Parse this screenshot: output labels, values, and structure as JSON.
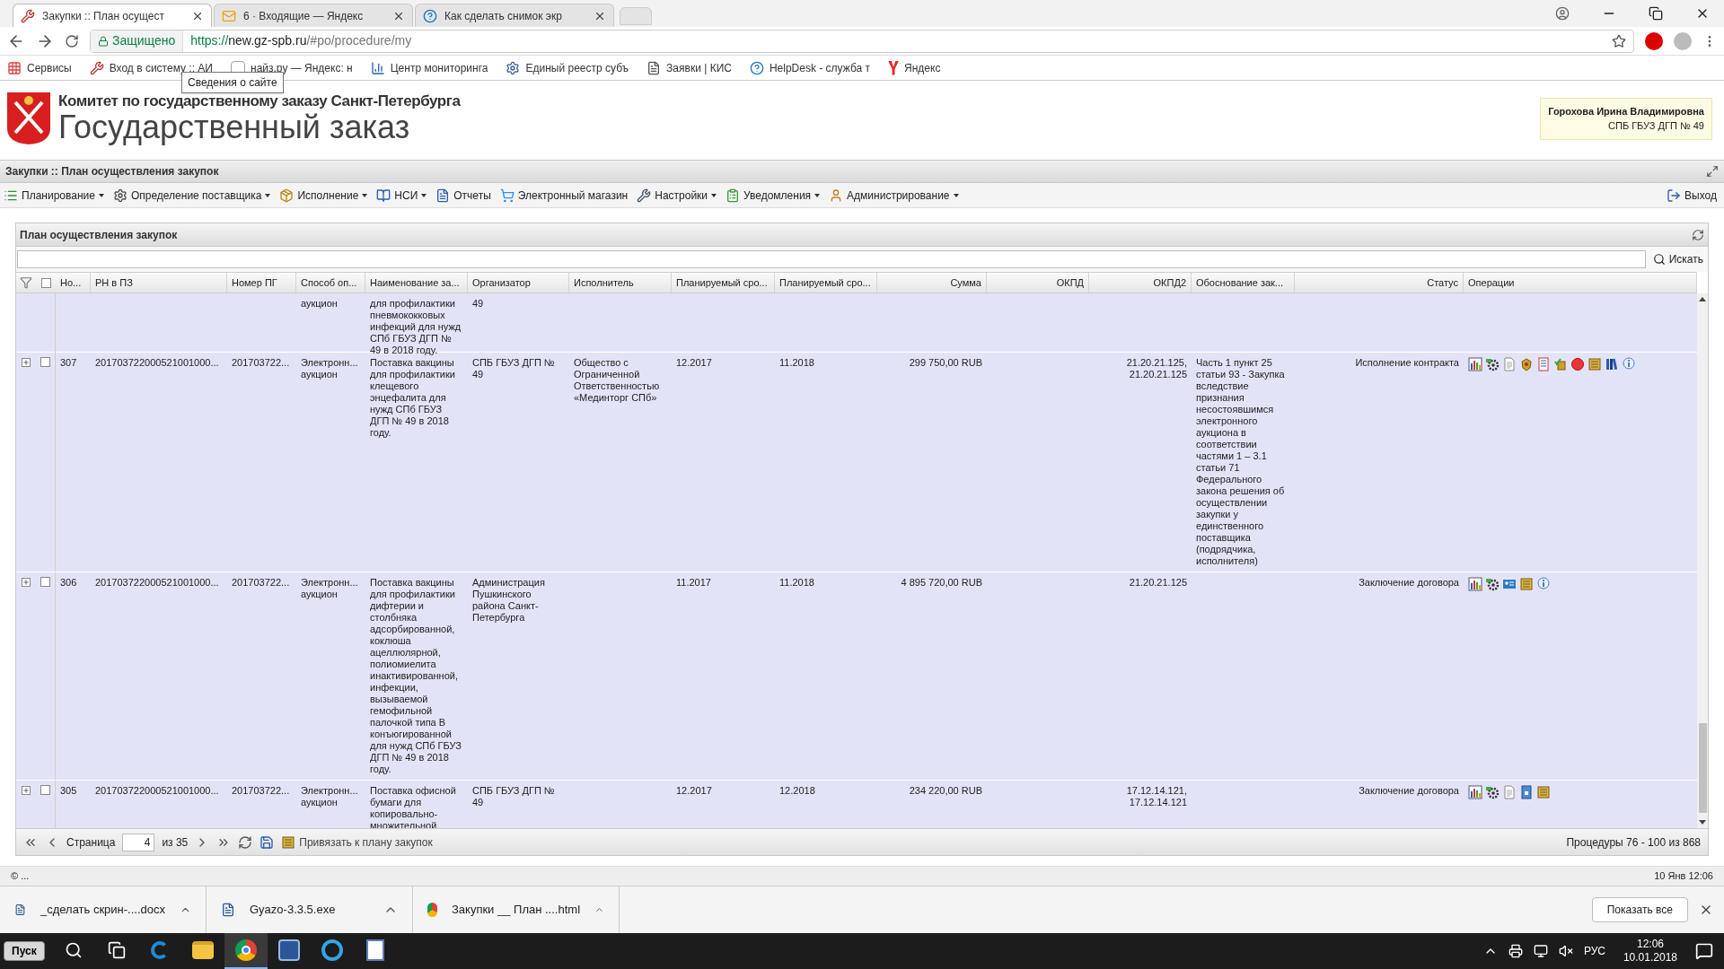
{
  "browser": {
    "tabs": [
      {
        "title": "Закупки :: План осущест",
        "kind": "tools",
        "selected": true
      },
      {
        "title": "6 · Входящие — Яндекс",
        "kind": "mail",
        "selected": false
      },
      {
        "title": "Как сделать снимок экр",
        "kind": "help",
        "selected": false
      }
    ],
    "secure_label": "Защищено",
    "url_scheme": "https://",
    "url_host": "new.gz-spb.ru",
    "url_path": "/#po/procedure/my",
    "bookmarks": [
      {
        "label": "Сервисы",
        "kind": "apps"
      },
      {
        "label": "Вход в систему :: АИ",
        "kind": "tools"
      },
      {
        "label": "найз.ру — Яндекс: н",
        "kind": "ya"
      },
      {
        "label": "Центр мониторинга",
        "kind": "bars"
      },
      {
        "label": "Единый реестр субъ",
        "kind": "seal"
      },
      {
        "label": "Заявки | КИС",
        "kind": "page"
      },
      {
        "label": "HelpDesk - служба т",
        "kind": "help"
      },
      {
        "label": "Яндекс",
        "kind": "yandex"
      }
    ],
    "tooltip": "Сведения о сайте"
  },
  "header": {
    "subtitle": "Комитет по государственному заказу Санкт-Петербурга",
    "title": "Государственный заказ",
    "user_name": "Горохова Ирина Владимировна",
    "user_org": "СПБ ГБУЗ ДГП № 49"
  },
  "breadcrumb": "Закупки :: План осуществления закупок",
  "menu": [
    {
      "label": "Планирование",
      "kind": "list",
      "dropdown": true
    },
    {
      "label": "Определение поставщика",
      "kind": "gears",
      "dropdown": true
    },
    {
      "label": "Исполнение",
      "kind": "box",
      "dropdown": true
    },
    {
      "label": "НСИ",
      "kind": "book",
      "dropdown": true
    },
    {
      "label": "Отчеты",
      "kind": "doc",
      "dropdown": false
    },
    {
      "label": "Электронный магазин",
      "kind": "cart",
      "dropdown": false
    },
    {
      "label": "Настройки",
      "kind": "wrench",
      "dropdown": true
    },
    {
      "label": "Уведомления",
      "kind": "note",
      "dropdown": true
    },
    {
      "label": "Администрирование",
      "kind": "user",
      "dropdown": true
    }
  ],
  "exit": "Выход",
  "panel": {
    "title": "План осуществления закупок",
    "search_button": "Искать",
    "table": {
      "select_all": {
        "checked": false
      },
      "columns": [
        {
          "label": "Но..."
        },
        {
          "label": "РН в ПЗ"
        },
        {
          "label": "Номер ПГ"
        },
        {
          "label": "Способ оп..."
        },
        {
          "label": "Наименование за..."
        },
        {
          "label": "Организатор"
        },
        {
          "label": "Исполнитель"
        },
        {
          "label": "Планируемый сро..."
        },
        {
          "label": "Планируемый сро..."
        },
        {
          "label": "Сумма"
        },
        {
          "label": "ОКПД"
        },
        {
          "label": "ОКПД2"
        },
        {
          "label": "Обоснование зак..."
        },
        {
          "label": "Статус"
        },
        {
          "label": "Операции"
        }
      ],
      "rows": [
        {
          "cells": [
            "",
            "",
            "",
            "аукцион",
            "для профилактики пневмококковых инфекций для нужд СПб ГБУЗ ДГП № 49 в 2018 году.",
            "49",
            "",
            "",
            "",
            "",
            "",
            "",
            "",
            "",
            ""
          ],
          "ops": []
        },
        {
          "checked": false,
          "cells": [
            "307",
            "201703722000521001000...",
            "201703722...",
            "Электронн... аукцион",
            "Поставка вакцины для профилактики клещевого энцефалита для нужд СПб ГБУЗ ДГП № 49 в 2018 году.",
            "СПБ ГБУЗ ДГП № 49",
            "Общество с Ограниченной Ответственностью «Мединторг СПб»",
            "12.2017",
            "11.2018",
            "299 750,00 RUB",
            "",
            "21.20.21.125, 21.20.21.125",
            "Часть 1 пункт 25 статьи 93 - Закупка вследствие признания несостоявшимся электронного аукциона в соответствии частями 1 – 3.1 статьи 71 Федерального закона решения об осуществлении закупки у единственного поставщика (подрядчика, исполнителя)",
            "Исполнение контракта",
            ""
          ],
          "ops": [
            {
              "kind": "chart"
            },
            {
              "kind": "gear"
            },
            {
              "kind": "doc"
            },
            {
              "kind": "emblem"
            },
            {
              "kind": "journal"
            },
            {
              "kind": "check"
            },
            {
              "kind": "record"
            },
            {
              "kind": "scroll"
            },
            {
              "kind": "books"
            },
            {
              "kind": "info"
            }
          ]
        },
        {
          "checked": false,
          "cells": [
            "306",
            "201703722000521001000...",
            "201703722...",
            "Электронн... аукцион",
            "Поставка вакцины для профилактики дифтерии и столбняка адсорбированной, коклюша ацеллюлярной, полиомиелита инактивированной, инфекции, вызываемой гемофильной палочкой типа В конъюгированной для нужд СПб ГБУЗ ДГП № 49 в 2018 году.",
            "Администрация Пушкинского района Санкт-Петербурга",
            "",
            "11.2017",
            "11.2018",
            "4 895 720,00 RUB",
            "",
            "21.20.21.125",
            "",
            "Заключение договора",
            ""
          ],
          "ops": [
            {
              "kind": "chart"
            },
            {
              "kind": "gear"
            },
            {
              "kind": "card"
            },
            {
              "kind": "scroll"
            },
            {
              "kind": "info"
            }
          ]
        },
        {
          "checked": false,
          "cells": [
            "305",
            "201703722000521001000...",
            "201703722...",
            "Электронн... аукцион",
            "Поставка офисной бумаги для копировально-множительной",
            "СПБ ГБУЗ ДГП № 49",
            "",
            "12.2017",
            "12.2018",
            "234 220,00 RUB",
            "",
            "17.12.14.121, 17.12.14.121",
            "",
            "Заключение договора",
            ""
          ],
          "ops": [
            {
              "kind": "chart"
            },
            {
              "kind": "gear"
            },
            {
              "kind": "doc"
            },
            {
              "kind": "lock"
            },
            {
              "kind": "scroll"
            }
          ]
        }
      ]
    },
    "pager": {
      "page_label": "Страница",
      "page": "4",
      "of": "из 35",
      "bind": "Привязать к плану закупок",
      "summary": "Процедуры 76 - 100 из 868"
    }
  },
  "status_bar": {
    "left": "© ...",
    "right": "10 Янв 12:06"
  },
  "downloads": {
    "items": [
      {
        "name": "_сделать скрин-....docx",
        "kind": "word"
      },
      {
        "name": "Gyazo-3.3.5.exe",
        "kind": "exe"
      },
      {
        "name": "Закупки __ План ....html",
        "kind": "chrome"
      }
    ],
    "show_all": "Показать все"
  },
  "taskbar": {
    "start": "Пуск",
    "apps": [
      {
        "kind": "search",
        "selected": false
      },
      {
        "kind": "taskview",
        "selected": false
      },
      {
        "kind": "edge",
        "selected": false
      },
      {
        "kind": "folder",
        "selected": false
      },
      {
        "kind": "chrome",
        "selected": true
      },
      {
        "kind": "word",
        "selected": false
      },
      {
        "kind": "ie",
        "selected": false
      },
      {
        "kind": "doc",
        "selected": false
      }
    ],
    "lang": "РУС",
    "time": "12:06",
    "date": "10.01.2018"
  }
}
